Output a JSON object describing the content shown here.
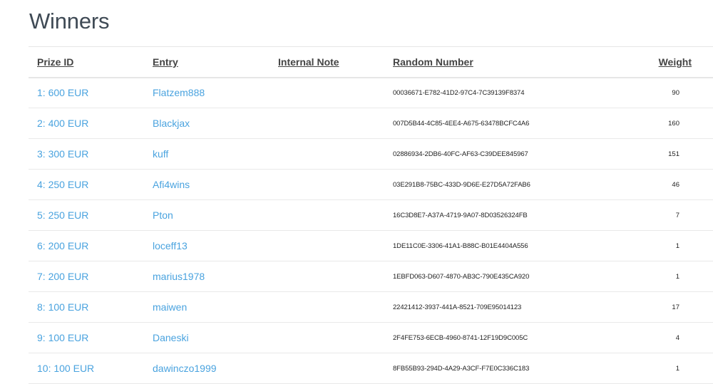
{
  "title": "Winners",
  "columns": {
    "prize_id": "Prize ID",
    "entry": "Entry",
    "internal_note": "Internal Note",
    "random_number": "Random Number",
    "weight": "Weight"
  },
  "rows": [
    {
      "prize": "1: 600 EUR",
      "entry": "Flatzem888",
      "note": "",
      "random": "00036671-E782-41D2-97C4-7C39139F8374",
      "weight": "90"
    },
    {
      "prize": "2: 400 EUR",
      "entry": "Blackjax",
      "note": "",
      "random": "007D5B44-4C85-4EE4-A675-63478BCFC4A6",
      "weight": "160"
    },
    {
      "prize": "3: 300 EUR",
      "entry": "kuff",
      "note": "",
      "random": "02886934-2DB6-40FC-AF63-C39DEE845967",
      "weight": "151"
    },
    {
      "prize": "4: 250 EUR",
      "entry": "Afi4wins",
      "note": "",
      "random": "03E291B8-75BC-433D-9D6E-E27D5A72FAB6",
      "weight": "46"
    },
    {
      "prize": "5: 250 EUR",
      "entry": "Pton",
      "note": "",
      "random": "16C3D8E7-A37A-4719-9A07-8D03526324FB",
      "weight": "7"
    },
    {
      "prize": "6: 200 EUR",
      "entry": "loceff13",
      "note": "",
      "random": "1DE11C0E-3306-41A1-B88C-B01E4404A556",
      "weight": "1"
    },
    {
      "prize": "7: 200 EUR",
      "entry": "marius1978",
      "note": "",
      "random": "1EBFD063-D607-4870-AB3C-790E435CA920",
      "weight": "1"
    },
    {
      "prize": "8: 100 EUR",
      "entry": "maiwen",
      "note": "",
      "random": "22421412-3937-441A-8521-709E95014123",
      "weight": "17"
    },
    {
      "prize": "9: 100 EUR",
      "entry": "Daneski",
      "note": "",
      "random": "2F4FE753-6ECB-4960-8741-12F19D9C005C",
      "weight": "4"
    },
    {
      "prize": "10: 100 EUR",
      "entry": "dawinczo1999",
      "note": "",
      "random": "8FB55B93-294D-4A29-A3CF-F7E0C336C183",
      "weight": "1"
    }
  ]
}
